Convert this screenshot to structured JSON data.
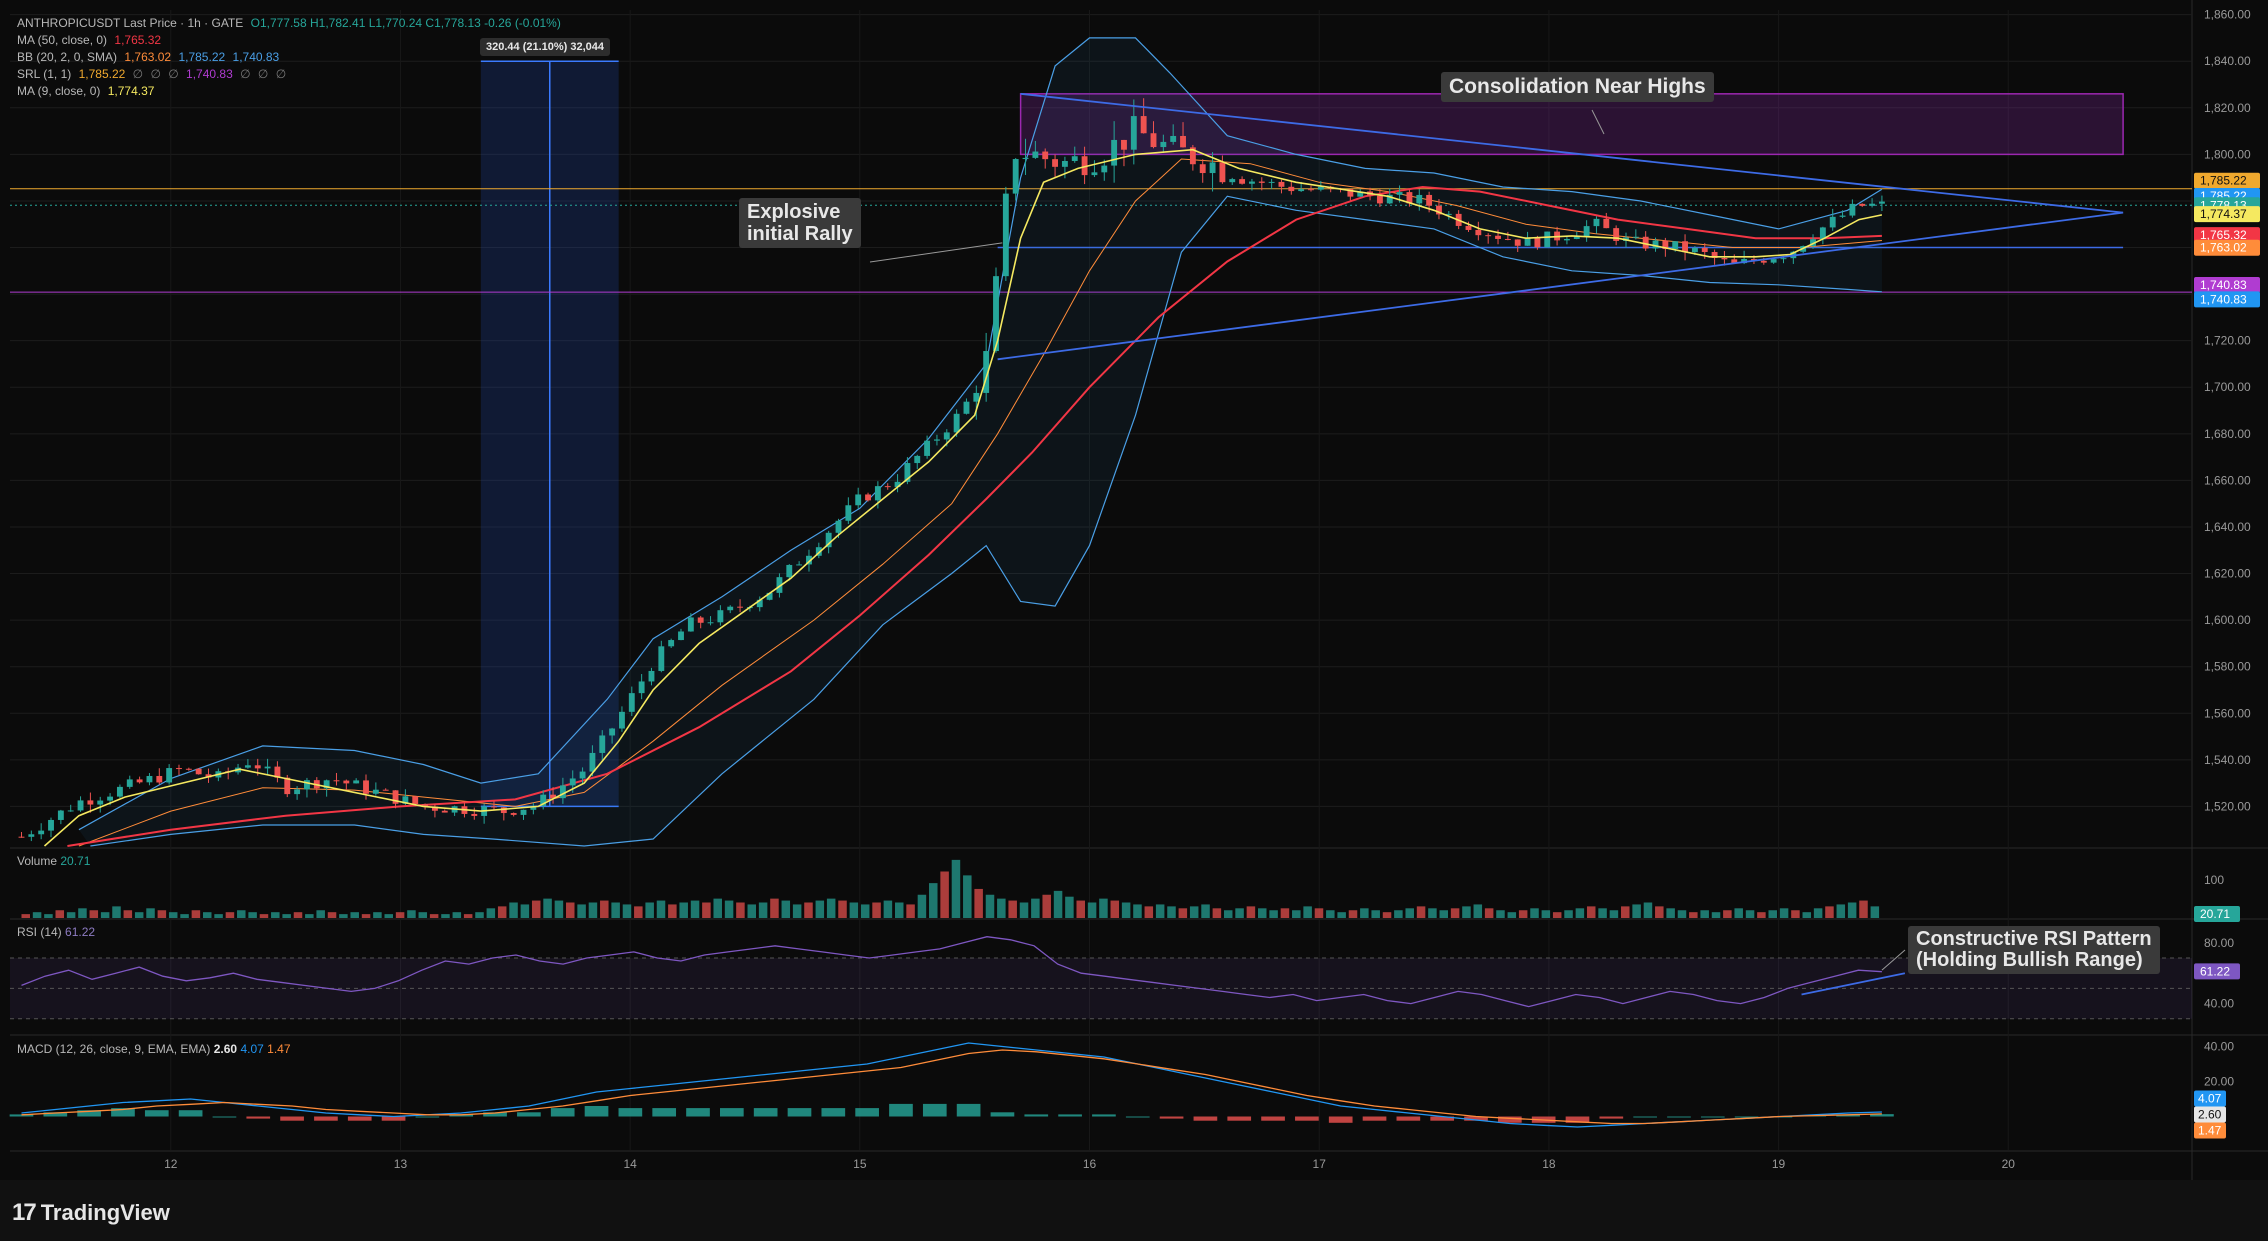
{
  "header": {
    "symbol": "ANTHROPICUSDT Last Price · 1h · GATE",
    "ohlc": "O1,777.58 H1,782.41 L1,770.24 C1,778.13 -0.26 (-0.01%)",
    "ma50": "MA (50, close, 0)",
    "ma50_val": "1,765.32",
    "bb": "BB (20, 2, 0, SMA)",
    "bb_vals": [
      "1,763.02",
      "1,785.22",
      "1,740.83"
    ],
    "srl": "SRL (1, 1)",
    "srl_vals": [
      "1,785.22",
      "∅",
      "∅",
      "∅",
      "1,740.83",
      "∅",
      "∅",
      "∅"
    ],
    "ma9": "MA (9, close, 0)",
    "ma9_val": "1,774.37"
  },
  "colors": {
    "up": "#26a69a",
    "down": "#ef5350",
    "ma9": "#f5e960",
    "ma50": "#f23645",
    "bb_mid": "#ff8c3a",
    "bb_band": "#4a9fe6",
    "trend": "#3d6be6",
    "consolidation": "#9c27b0",
    "srl_res": "#f0a92e",
    "srl_sup": "#b03cd1"
  },
  "annotations": {
    "rally": "Explosive\ninitial Rally",
    "consolidation": "Consolidation Near Highs",
    "rsi_pattern": "Constructive RSI Pattern\n(Holding Bullish Range)",
    "measure": "320.44 (21.10%) 32,044"
  },
  "price_tags": [
    {
      "label": "1,785.22",
      "color": "#f0a92e"
    },
    {
      "label": "1,785.22",
      "color": "#2196f3"
    },
    {
      "label": "1,778.13",
      "color": "#26a69a"
    },
    {
      "label": "1,774.37",
      "color": "#f5e960"
    },
    {
      "label": "1,765.32",
      "color": "#f23645"
    },
    {
      "label": "1,763.02",
      "color": "#ff8c3a"
    },
    {
      "label": "1,740.83",
      "color": "#b03cd1"
    },
    {
      "label": "1,740.83",
      "color": "#2196f3"
    }
  ],
  "volume": {
    "title": "Volume",
    "value": "20.71",
    "axis": [
      "100"
    ]
  },
  "rsi": {
    "title": "RSI (14)",
    "value": "61.22",
    "axis": [
      "80.00",
      "60.00",
      "40.00"
    ]
  },
  "macd": {
    "title": "MACD (12, 26, close, 9, EMA, EMA)",
    "values": [
      "2.60",
      "4.07",
      "1.47"
    ],
    "axis": [
      "40.00",
      "20.00"
    ]
  },
  "brand": "TradingView",
  "chart_data": {
    "type": "candlestick",
    "symbol": "ANTHROPICUSDT",
    "timeframe": "1h",
    "x_ticks": [
      "12",
      "13",
      "14",
      "15",
      "16",
      "17",
      "18",
      "19",
      "20"
    ],
    "y_ticks": [
      1520,
      1540,
      1560,
      1580,
      1600,
      1620,
      1640,
      1660,
      1680,
      1700,
      1720,
      1740,
      1760,
      1780,
      1800,
      1820,
      1840,
      1860
    ],
    "y_tick_labels": [
      "1,520.00",
      "1,540.00",
      "1,560.00",
      "1,580.00",
      "1,600.00",
      "1,620.00",
      "1,640.00",
      "1,660.00",
      "1,680.00",
      "1,700.00",
      "1,720.00",
      "1,740.00",
      "1,760.00",
      "1,780.00",
      "1,800.00",
      "1,820.00",
      "1,840.00",
      "1,860.00"
    ],
    "ylim": [
      1503,
      1862
    ],
    "xlim": [
      11.3,
      20.8
    ],
    "price_path": [
      [
        11.35,
        1507
      ],
      [
        11.6,
        1522
      ],
      [
        11.8,
        1528
      ],
      [
        12.05,
        1536
      ],
      [
        12.2,
        1532
      ],
      [
        12.35,
        1540
      ],
      [
        12.5,
        1528
      ],
      [
        12.7,
        1532
      ],
      [
        12.9,
        1526
      ],
      [
        13.1,
        1520
      ],
      [
        13.3,
        1519
      ],
      [
        13.45,
        1518
      ],
      [
        13.6,
        1521
      ],
      [
        13.8,
        1536
      ],
      [
        13.95,
        1558
      ],
      [
        14.1,
        1582
      ],
      [
        14.25,
        1598
      ],
      [
        14.4,
        1602
      ],
      [
        14.6,
        1612
      ],
      [
        14.8,
        1632
      ],
      [
        15.0,
        1652
      ],
      [
        15.15,
        1660
      ],
      [
        15.3,
        1675
      ],
      [
        15.45,
        1690
      ],
      [
        15.55,
        1712
      ],
      [
        15.62,
        1762
      ],
      [
        15.66,
        1802
      ],
      [
        15.75,
        1800
      ],
      [
        15.9,
        1796
      ],
      [
        16.05,
        1800
      ],
      [
        16.2,
        1810
      ],
      [
        16.35,
        1802
      ],
      [
        16.5,
        1798
      ],
      [
        16.65,
        1790
      ],
      [
        16.85,
        1786
      ],
      [
        17.05,
        1784
      ],
      [
        17.25,
        1782
      ],
      [
        17.45,
        1780
      ],
      [
        17.6,
        1772
      ],
      [
        17.75,
        1766
      ],
      [
        17.9,
        1762
      ],
      [
        18.05,
        1765
      ],
      [
        18.2,
        1770
      ],
      [
        18.35,
        1762
      ],
      [
        18.5,
        1761
      ],
      [
        18.65,
        1758
      ],
      [
        18.8,
        1752
      ],
      [
        18.95,
        1756
      ],
      [
        19.05,
        1758
      ],
      [
        19.15,
        1766
      ],
      [
        19.25,
        1772
      ],
      [
        19.35,
        1778
      ],
      [
        19.45,
        1778
      ]
    ],
    "ma9_path": [
      [
        11.45,
        1503
      ],
      [
        11.6,
        1516
      ],
      [
        11.8,
        1524
      ],
      [
        12.05,
        1530
      ],
      [
        12.3,
        1536
      ],
      [
        12.5,
        1532
      ],
      [
        12.7,
        1528
      ],
      [
        12.9,
        1524
      ],
      [
        13.1,
        1520
      ],
      [
        13.35,
        1518
      ],
      [
        13.6,
        1520
      ],
      [
        13.8,
        1530
      ],
      [
        13.95,
        1548
      ],
      [
        14.1,
        1570
      ],
      [
        14.3,
        1590
      ],
      [
        14.5,
        1604
      ],
      [
        14.7,
        1618
      ],
      [
        14.9,
        1636
      ],
      [
        15.1,
        1652
      ],
      [
        15.3,
        1668
      ],
      [
        15.5,
        1688
      ],
      [
        15.6,
        1720
      ],
      [
        15.7,
        1764
      ],
      [
        15.8,
        1788
      ],
      [
        15.95,
        1794
      ],
      [
        16.2,
        1800
      ],
      [
        16.45,
        1802
      ],
      [
        16.65,
        1794
      ],
      [
        16.9,
        1788
      ],
      [
        17.1,
        1785
      ],
      [
        17.3,
        1782
      ],
      [
        17.5,
        1776
      ],
      [
        17.7,
        1768
      ],
      [
        17.9,
        1764
      ],
      [
        18.1,
        1765
      ],
      [
        18.3,
        1764
      ],
      [
        18.5,
        1760
      ],
      [
        18.7,
        1756
      ],
      [
        18.9,
        1756
      ],
      [
        19.05,
        1757
      ],
      [
        19.2,
        1764
      ],
      [
        19.35,
        1772
      ],
      [
        19.45,
        1774
      ]
    ],
    "ma50_path": [
      [
        11.55,
        1503
      ],
      [
        12.0,
        1510
      ],
      [
        12.5,
        1516
      ],
      [
        13.0,
        1520
      ],
      [
        13.5,
        1523
      ],
      [
        13.9,
        1534
      ],
      [
        14.3,
        1554
      ],
      [
        14.7,
        1578
      ],
      [
        15.0,
        1602
      ],
      [
        15.3,
        1628
      ],
      [
        15.55,
        1652
      ],
      [
        15.75,
        1672
      ],
      [
        16.0,
        1700
      ],
      [
        16.3,
        1730
      ],
      [
        16.6,
        1754
      ],
      [
        16.9,
        1772
      ],
      [
        17.2,
        1782
      ],
      [
        17.45,
        1786
      ],
      [
        17.7,
        1784
      ],
      [
        18.0,
        1778
      ],
      [
        18.3,
        1772
      ],
      [
        18.6,
        1768
      ],
      [
        18.9,
        1764
      ],
      [
        19.2,
        1764
      ],
      [
        19.45,
        1765
      ]
    ],
    "bb_mid_path": [
      [
        11.6,
        1503
      ],
      [
        12.0,
        1518
      ],
      [
        12.4,
        1528
      ],
      [
        12.8,
        1527
      ],
      [
        13.2,
        1523
      ],
      [
        13.5,
        1520
      ],
      [
        13.8,
        1526
      ],
      [
        14.1,
        1548
      ],
      [
        14.4,
        1572
      ],
      [
        14.8,
        1600
      ],
      [
        15.1,
        1624
      ],
      [
        15.4,
        1650
      ],
      [
        15.6,
        1680
      ],
      [
        15.8,
        1714
      ],
      [
        16.0,
        1750
      ],
      [
        16.2,
        1780
      ],
      [
        16.4,
        1798
      ],
      [
        16.7,
        1796
      ],
      [
        17.0,
        1788
      ],
      [
        17.3,
        1784
      ],
      [
        17.6,
        1778
      ],
      [
        17.9,
        1770
      ],
      [
        18.2,
        1766
      ],
      [
        18.5,
        1763
      ],
      [
        18.8,
        1760
      ],
      [
        19.1,
        1760
      ],
      [
        19.45,
        1763
      ]
    ],
    "bb_upper_path": [
      [
        11.6,
        1510
      ],
      [
        12.0,
        1532
      ],
      [
        12.4,
        1546
      ],
      [
        12.8,
        1544
      ],
      [
        13.1,
        1538
      ],
      [
        13.35,
        1530
      ],
      [
        13.6,
        1534
      ],
      [
        13.9,
        1566
      ],
      [
        14.1,
        1592
      ],
      [
        14.4,
        1610
      ],
      [
        14.7,
        1630
      ],
      [
        15.0,
        1648
      ],
      [
        15.3,
        1678
      ],
      [
        15.55,
        1710
      ],
      [
        15.7,
        1790
      ],
      [
        15.85,
        1838
      ],
      [
        16.0,
        1850
      ],
      [
        16.2,
        1850
      ],
      [
        16.35,
        1835
      ],
      [
        16.6,
        1808
      ],
      [
        16.9,
        1800
      ],
      [
        17.2,
        1794
      ],
      [
        17.5,
        1792
      ],
      [
        17.8,
        1786
      ],
      [
        18.1,
        1784
      ],
      [
        18.4,
        1780
      ],
      [
        18.7,
        1774
      ],
      [
        19.0,
        1768
      ],
      [
        19.3,
        1776
      ],
      [
        19.45,
        1785
      ]
    ],
    "bb_lower_path": [
      [
        11.65,
        1503
      ],
      [
        12.0,
        1508
      ],
      [
        12.4,
        1512
      ],
      [
        12.8,
        1512
      ],
      [
        13.1,
        1508
      ],
      [
        13.4,
        1506
      ],
      [
        13.8,
        1503
      ],
      [
        14.1,
        1506
      ],
      [
        14.4,
        1534
      ],
      [
        14.8,
        1566
      ],
      [
        15.1,
        1598
      ],
      [
        15.4,
        1620
      ],
      [
        15.55,
        1632
      ],
      [
        15.7,
        1608
      ],
      [
        15.85,
        1606
      ],
      [
        16.0,
        1632
      ],
      [
        16.2,
        1688
      ],
      [
        16.4,
        1758
      ],
      [
        16.6,
        1782
      ],
      [
        16.9,
        1776
      ],
      [
        17.2,
        1772
      ],
      [
        17.5,
        1768
      ],
      [
        17.8,
        1756
      ],
      [
        18.1,
        1750
      ],
      [
        18.4,
        1748
      ],
      [
        18.7,
        1745
      ],
      [
        19.0,
        1744
      ],
      [
        19.3,
        1742
      ],
      [
        19.45,
        1741
      ]
    ],
    "trendline_upper": [
      [
        15.7,
        1826
      ],
      [
        20.5,
        1775
      ]
    ],
    "trendline_lower": [
      [
        15.6,
        1712
      ],
      [
        20.5,
        1775
      ]
    ],
    "horizontal_level": 1760,
    "srl_resistance": 1785.22,
    "srl_support": 1740.83,
    "consolidation_box": {
      "x1": 15.7,
      "x2": 20.5,
      "y1": 1800,
      "y2": 1826
    },
    "measure": {
      "x1": 13.35,
      "x2": 13.95,
      "from": 1520,
      "to": 1840,
      "label": "320.44 (21.10%) 32,044"
    },
    "volume_values": [
      2,
      3,
      2,
      4,
      3,
      5,
      4,
      3,
      6,
      4,
      3,
      5,
      4,
      3,
      2,
      4,
      3,
      2,
      3,
      4,
      3,
      2,
      3,
      2,
      3,
      2,
      4,
      3,
      2,
      3,
      2,
      3,
      2,
      3,
      4,
      3,
      2,
      2,
      3,
      2,
      3,
      5,
      6,
      8,
      7,
      9,
      10,
      9,
      8,
      7,
      8,
      9,
      8,
      7,
      6,
      8,
      9,
      7,
      8,
      9,
      8,
      10,
      9,
      8,
      7,
      8,
      10,
      9,
      7,
      8,
      9,
      10,
      9,
      8,
      7,
      8,
      9,
      8,
      7,
      12,
      18,
      24,
      30,
      22,
      15,
      12,
      10,
      9,
      8,
      10,
      12,
      14,
      11,
      9,
      8,
      10,
      9,
      8,
      7,
      6,
      7,
      6,
      5,
      6,
      7,
      5,
      4,
      5,
      6,
      5,
      4,
      5,
      4,
      6,
      5,
      4,
      3,
      4,
      5,
      4,
      3,
      4,
      5,
      6,
      5,
      4,
      5,
      6,
      7,
      5,
      4,
      3,
      4,
      5,
      4,
      3,
      4,
      5,
      6,
      5,
      4,
      6,
      7,
      8,
      6,
      5,
      4,
      3,
      4,
      3,
      4,
      5,
      4,
      3,
      4,
      5,
      4,
      3,
      5,
      6,
      7,
      8,
      9,
      6
    ],
    "rsi_series": [
      52,
      58,
      62,
      56,
      60,
      64,
      58,
      55,
      57,
      60,
      56,
      54,
      52,
      50,
      48,
      50,
      55,
      62,
      68,
      66,
      70,
      72,
      68,
      66,
      70,
      72,
      74,
      70,
      68,
      72,
      74,
      76,
      78,
      76,
      74,
      72,
      70,
      72,
      74,
      76,
      80,
      84,
      82,
      78,
      66,
      60,
      58,
      56,
      54,
      52,
      50,
      48,
      46,
      44,
      46,
      42,
      44,
      46,
      42,
      40,
      44,
      48,
      46,
      42,
      38,
      42,
      46,
      44,
      40,
      44,
      48,
      46,
      42,
      40,
      44,
      50,
      54,
      58,
      62,
      61
    ],
    "macd_line": [
      2,
      4,
      6,
      8,
      9,
      10,
      8,
      6,
      4,
      2,
      1,
      0,
      1,
      2,
      4,
      6,
      10,
      14,
      16,
      18,
      20,
      22,
      24,
      26,
      28,
      30,
      34,
      38,
      42,
      40,
      38,
      36,
      34,
      30,
      26,
      22,
      18,
      14,
      10,
      6,
      4,
      2,
      0,
      -2,
      -4,
      -5,
      -6,
      -5,
      -4,
      -3,
      -2,
      -1,
      0,
      1,
      2,
      2.6
    ],
    "signal_line": [
      1,
      2,
      3,
      4,
      6,
      7,
      8,
      7,
      6,
      4,
      3,
      2,
      1,
      1,
      2,
      4,
      6,
      9,
      12,
      14,
      16,
      18,
      20,
      22,
      24,
      26,
      28,
      32,
      36,
      38,
      37,
      35,
      33,
      30,
      27,
      24,
      20,
      16,
      12,
      9,
      6,
      4,
      2,
      0,
      -1,
      -2,
      -3,
      -4,
      -4,
      -3,
      -2,
      -1,
      0,
      0.5,
      1,
      1.47
    ]
  }
}
